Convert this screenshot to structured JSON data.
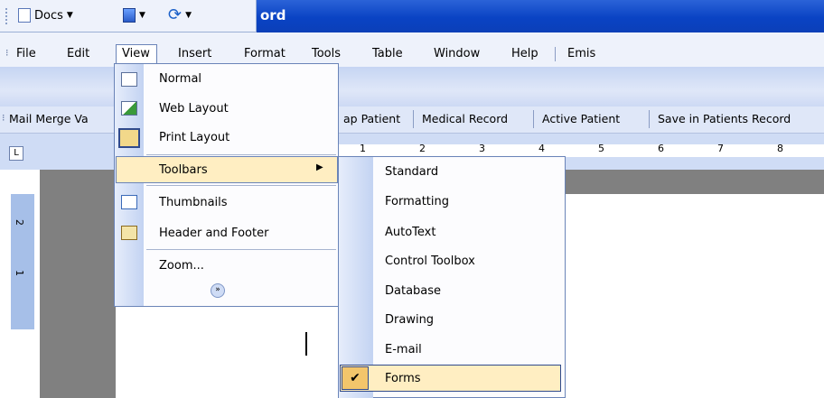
{
  "window": {
    "title_fragment": "ord"
  },
  "quick_toolbar": {
    "docs_label": "Docs"
  },
  "menubar": [
    {
      "id": "file",
      "label": "File"
    },
    {
      "id": "edit",
      "label": "Edit"
    },
    {
      "id": "view",
      "label": "View"
    },
    {
      "id": "insert",
      "label": "Insert"
    },
    {
      "id": "format",
      "label": "Format"
    },
    {
      "id": "tools",
      "label": "Tools"
    },
    {
      "id": "table",
      "label": "Table"
    },
    {
      "id": "window",
      "label": "Window"
    },
    {
      "id": "help",
      "label": "Help"
    },
    {
      "id": "emis",
      "label": "Emis"
    }
  ],
  "mailmerge_toolbar": [
    "Mail Merge Va",
    "ap Patient",
    "Medical Record",
    "Active Patient",
    "Save in Patients Record"
  ],
  "ruler": {
    "numbers": [
      "1",
      "2",
      "3",
      "4",
      "5",
      "6",
      "7",
      "8"
    ]
  },
  "vertical_ruler": {
    "numbers": [
      "2",
      "1"
    ]
  },
  "view_menu": {
    "items": [
      {
        "label": "Normal"
      },
      {
        "label": "Web Layout"
      },
      {
        "label": "Print Layout"
      },
      {
        "label": "Toolbars",
        "has_submenu": true
      },
      {
        "label": "Thumbnails"
      },
      {
        "label": "Header and Footer"
      },
      {
        "label": "Zoom..."
      }
    ]
  },
  "toolbars_submenu": {
    "items": [
      {
        "label": "Standard"
      },
      {
        "label": "Formatting"
      },
      {
        "label": "AutoText"
      },
      {
        "label": "Control Toolbox"
      },
      {
        "label": "Database"
      },
      {
        "label": "Drawing"
      },
      {
        "label": "E-mail"
      },
      {
        "label": "Forms",
        "checked": true,
        "highlighted": true
      }
    ]
  },
  "colors": {
    "titlebar": "#0a43c4",
    "menu_highlight": "#ffeec2",
    "check_bg": "#f3c56b"
  }
}
